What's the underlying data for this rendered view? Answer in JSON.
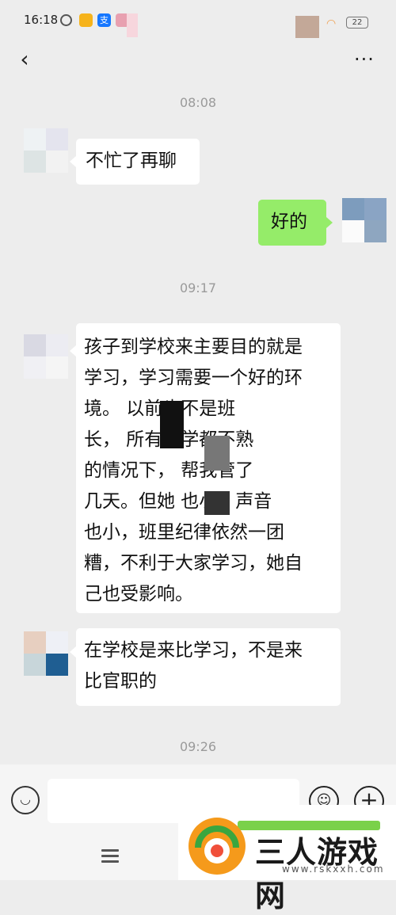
{
  "status_bar": {
    "time": "16:18",
    "pay_icon_label": "支",
    "battery": "22"
  },
  "nav": {
    "back_icon": "‹",
    "more_icon": "···"
  },
  "messages": {
    "ts1": "08:08",
    "msg1": "不忙了再聊",
    "msg2": "好的",
    "ts2": "09:17",
    "msg3": [
      "孩子到学校来主要目的就是",
      "学习，学习需要一个好的环",
      "境。        以前也不是班",
      "长，        所有同学都不熟",
      "的情况下，        帮我管了",
      "几天。但她        也小，声音",
      "也小，班里纪律依然一团",
      "糟，不利于大家学习，她自",
      "己也受影响。"
    ],
    "msg4": [
      "在学校是来比学习，不是来",
      "比官职的"
    ],
    "ts3": "09:26"
  },
  "input_bar": {
    "voice_icon": "◡",
    "emoji_icon": "☺",
    "plus_icon": "+"
  },
  "watermark": {
    "title": "三人游戏网",
    "url": "www.rskxxh.com"
  },
  "colors": {
    "background": "#ededed",
    "bubble_in": "#ffffff",
    "bubble_out": "#95ec69"
  }
}
